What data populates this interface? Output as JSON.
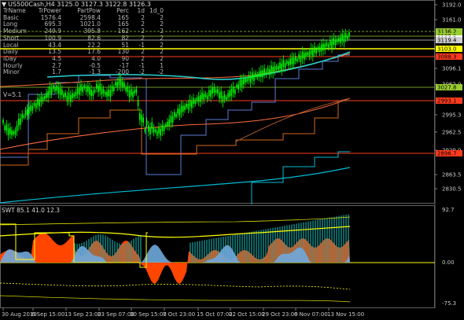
{
  "header": {
    "symbol_line": "US500Cash,H4  3125.0  3127.3  3122.8  3126.3",
    "caret": "▼"
  },
  "stats_table": {
    "columns": [
      "TrName",
      "TrPower",
      "PartPow",
      "Perc",
      "1d",
      "1d_0"
    ],
    "rows": [
      [
        "Basic",
        "1576.4",
        "2598.4",
        "165",
        "2",
        "2"
      ],
      [
        "Long",
        "695.3",
        "1021.0",
        "165",
        "2",
        "2"
      ],
      [
        "Medium",
        "249.9",
        "395.8",
        "162",
        "2",
        "2"
      ],
      [
        "Short",
        "100.9",
        "82.6",
        "82",
        "2",
        "2"
      ],
      [
        "Local",
        "43.4",
        "22.2",
        "51",
        "-1",
        "2"
      ],
      [
        "Daily",
        "13.5",
        "17.6",
        "130",
        "2",
        "2"
      ],
      [
        "IDay",
        "4.5",
        "4.0",
        "90",
        "2",
        "2"
      ],
      [
        "Hourly",
        "2.7",
        "-0.5",
        "-17",
        "-1",
        "1"
      ],
      [
        "Minor",
        "1.7",
        "-1.3",
        "-200",
        "-2",
        "-2"
      ]
    ],
    "footer": "V=5.1"
  },
  "price_axis": {
    "labels": [
      "3192.0",
      "3161.0",
      "3096.1",
      "3062.0",
      "2995.3",
      "2962.5",
      "2929.0",
      "2863.5",
      "2830.5"
    ],
    "tags": [
      {
        "text": "3136.2",
        "color": "#9acd32"
      },
      {
        "text": "3129.6",
        "color": "#9acd32"
      },
      {
        "text": "3126.3",
        "color": "#ffffff"
      },
      {
        "text": "3119.4",
        "color": "#d0d0d0"
      },
      {
        "text": "3103.0",
        "color": "#ffff00"
      },
      {
        "text": "3088.3",
        "color": "#ff3b1f"
      },
      {
        "text": "3027.8",
        "color": "#9acd32"
      },
      {
        "text": "2993.1",
        "color": "#ff3b1f"
      },
      {
        "text": "2896.7",
        "color": "#ff3b1f"
      }
    ]
  },
  "oscillator": {
    "title": "SWT 85.1 41.0 12.3",
    "axis_labels": [
      "92.7",
      "0.00",
      "-75.3"
    ]
  },
  "time_axis": {
    "labels": [
      "30 Aug 2019",
      "6 Sep 15:00",
      "13 Sep 23:00",
      "23 Sep 07:00",
      "30 Sep 15:00",
      "7 Oct 23:00",
      "15 Oct 07:00",
      "22 Oct 15:00",
      "29 Oct 23:00",
      "6 Nov 07:00",
      "13 Nov 15:00"
    ]
  },
  "colors": {
    "candle": "#00ff00",
    "grid_red": "#ff2a00",
    "yellow": "#ffff00",
    "cyan": "#00bcd4",
    "blue": "#5b7bd5",
    "osc_orange": "#ff4500",
    "osc_teal": "#1aa3a3",
    "osc_blue": "#6fa8dc"
  }
}
